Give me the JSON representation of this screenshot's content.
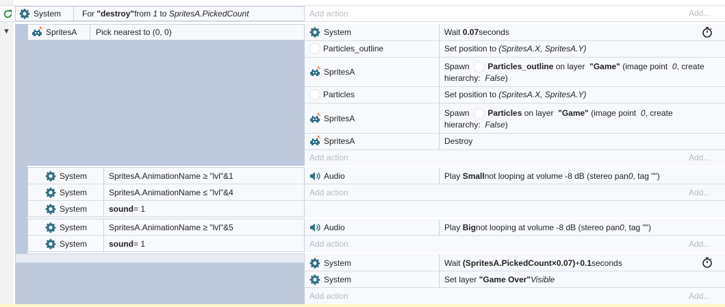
{
  "colors": {
    "accent": "#2f6f86",
    "block": "#bdc9dc",
    "add_text": "#b5b9c0",
    "bottom_bar": "#fff9c4"
  },
  "add_action": "Add action",
  "add_more": "Add...",
  "e1": {
    "object": "System",
    "cond_pre": "For ",
    "cond_name": "\"destroy\"",
    "cond_mid": " from ",
    "cond_from": "1",
    "cond_to_label": " to ",
    "cond_to": "SpritesA.PickedCount"
  },
  "e2": {
    "object": "SpritesA",
    "condition": "Pick nearest to (0, 0)",
    "actions": {
      "a1_obj": "System",
      "a1_pre": "Wait ",
      "a1_val": "0.07",
      "a1_post": " seconds",
      "a2_obj": "Particles_outline",
      "a2_pre": "Set position to ",
      "a2_val": "(SpritesA.X, SpritesA.Y)",
      "a3_obj": "SpritesA",
      "a3_pre": "Spawn ",
      "a3_name": "Particles_outline",
      "a3_mid": " on layer ",
      "a3_layer": "\"Game\"",
      "a3_rest1": " (image point ",
      "a3_pt": "0",
      "a3_rest2": ", create hierarchy: ",
      "a3_h": "False",
      "a3_end": ")",
      "a4_obj": "Particles",
      "a4_pre": "Set position to ",
      "a4_val": "(SpritesA.X, SpritesA.Y)",
      "a5_obj": "SpritesA",
      "a5_pre": "Spawn ",
      "a5_name": "Particles",
      "a5_mid": " on layer ",
      "a5_layer": "\"Game\"",
      "a5_rest1": " (image point ",
      "a5_pt": "0",
      "a5_rest2": ", create hierarchy: ",
      "a5_h": "False",
      "a5_end": ")",
      "a6_obj": "SpritesA",
      "a6_text": "Destroy"
    }
  },
  "e3": {
    "c1_obj": "System",
    "c1": "SpritesA.AnimationName ≥ \"lvl\"&1",
    "c2_obj": "System",
    "c2": "SpritesA.AnimationName ≤ \"lvl\"&4",
    "c3_obj": "System",
    "c3_var": "sound",
    "c3_rest": " = 1",
    "a_obj": "Audio",
    "a_pre": "Play ",
    "a_name": "Small",
    "a_rest": " not looping at volume -8 dB (stereo pan ",
    "a_pan": "0",
    "a_end": ", tag \"\")"
  },
  "e4": {
    "c1_obj": "System",
    "c1": "SpritesA.AnimationName ≥ \"lvl\"&5",
    "c2_obj": "System",
    "c2_var": "sound",
    "c2_rest": " = 1",
    "a_obj": "Audio",
    "a_pre": "Play ",
    "a_name": "Big",
    "a_rest": " not looping at volume -8 dB (stereo pan ",
    "a_pan": "0",
    "a_end": ", tag \"\")"
  },
  "e5": {
    "a1_obj": "System",
    "a1_pre": "Wait ",
    "a1_val": "(SpritesA.PickedCount×0.07)",
    "a1_plus": "+",
    "a1_num": "0.1",
    "a1_post": " seconds",
    "a2_obj": "System",
    "a2_pre": "Set layer ",
    "a2_layer": "\"Game Over\"",
    "a2_vis": " Visible"
  },
  "icons": {
    "gear": "gear-icon",
    "sprite": "sprite-icon",
    "audio": "speaker-icon",
    "timer": "stopwatch-icon",
    "loop": "loop-icon",
    "collapse": "collapse-triangle-icon",
    "object": "object-icon"
  }
}
